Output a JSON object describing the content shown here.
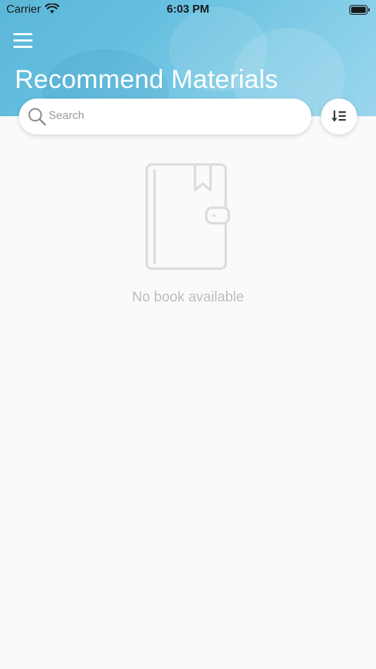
{
  "status_bar": {
    "carrier": "Carrier",
    "time": "6:03 PM"
  },
  "header": {
    "title": "Recommend Materials",
    "menu_icon": "hamburger-menu-icon"
  },
  "search": {
    "placeholder": "Search",
    "value": "",
    "icon": "search-icon"
  },
  "sort": {
    "icon": "sort-list-icon"
  },
  "empty_state": {
    "icon": "book-icon",
    "message": "No book available"
  },
  "colors": {
    "header_blue": "#66bfdf",
    "background": "#fafafa",
    "muted_text": "#bdbdbd",
    "icon_gray": "#dcdcdc"
  }
}
